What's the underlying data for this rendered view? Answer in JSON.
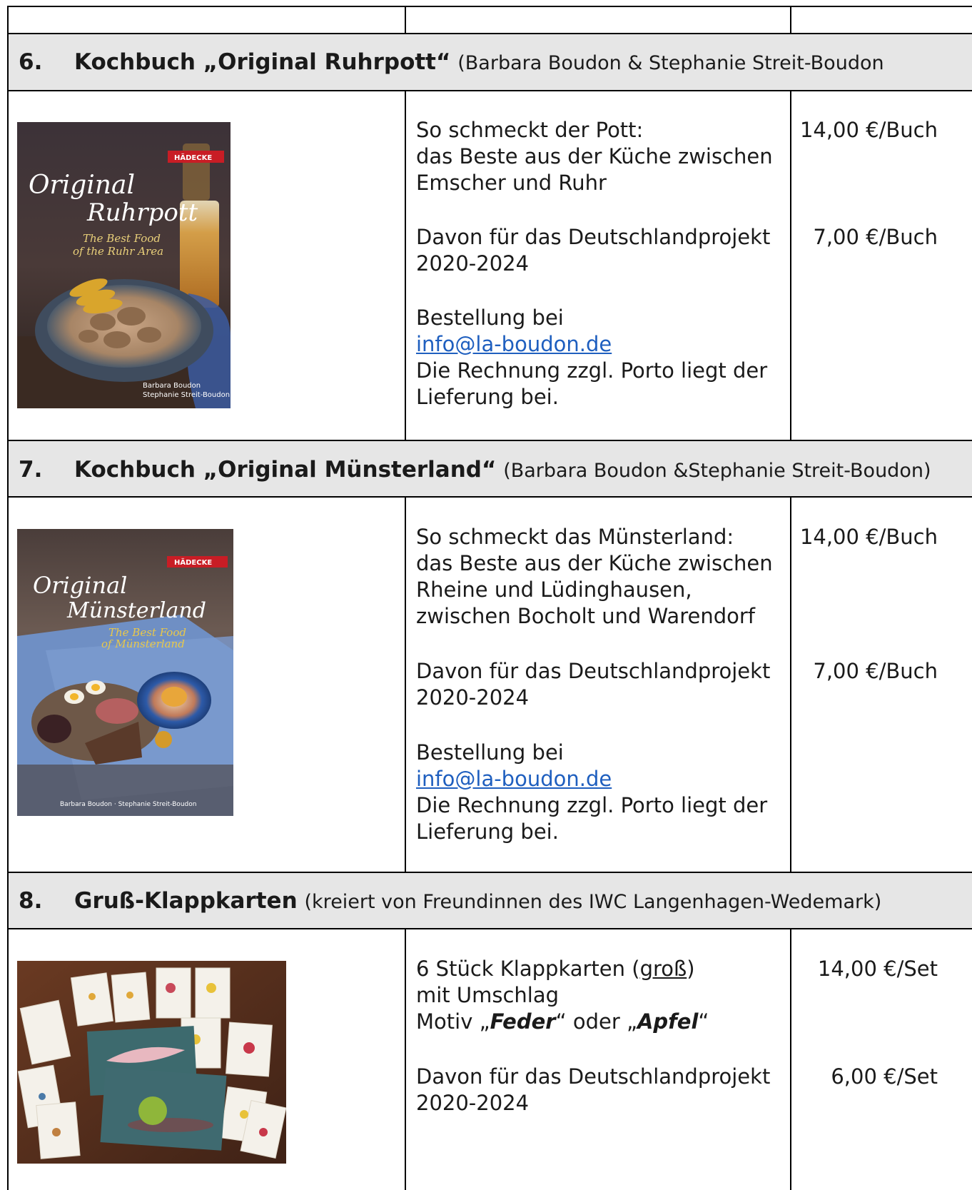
{
  "sections": [
    {
      "number": "6.",
      "title": "Kochbuch „Original Ruhrpott“",
      "subtitle": "(Barbara Boudon & Stephanie Streit-Boudon",
      "cover": {
        "publisher": "HÄDECKE",
        "title_line1": "Original",
        "title_line2": "Ruhrpott",
        "tagline1": "The Best Food",
        "tagline2": "of the Ruhr Area",
        "author1": "Barbara Boudon",
        "author2": "Stephanie Streit-Boudon"
      },
      "desc": [
        "So schmeckt der Pott:",
        "das Beste aus der Küche zwischen",
        "Emscher und Ruhr"
      ],
      "project": [
        "Davon für das Deutschlandprojekt",
        "2020-2024"
      ],
      "order_label": "Bestellung bei",
      "email": "info@la-boudon.de",
      "invoice": [
        "Die Rechnung zzgl. Porto liegt der",
        "Lieferung bei."
      ],
      "price": "14,00 €/Buch",
      "donation": "7,00 €/Buch"
    },
    {
      "number": "7.",
      "title": "Kochbuch „Original Münsterland“",
      "subtitle": "(Barbara Boudon &Stephanie Streit-Boudon)",
      "cover": {
        "publisher": "HÄDECKE",
        "title_line1": "Original",
        "title_line2": "Münsterland",
        "tagline1": "The Best Food",
        "tagline2": "of Münsterland",
        "authors": "Barbara Boudon · Stephanie Streit-Boudon"
      },
      "desc": [
        "So schmeckt das Münsterland:",
        "das Beste aus der Küche zwischen",
        "Rheine und Lüdinghausen,",
        "zwischen Bocholt und Warendorf"
      ],
      "project": [
        "Davon für das Deutschlandprojekt",
        "2020-2024"
      ],
      "order_label": "Bestellung bei",
      "email": "info@la-boudon.de",
      "invoice": [
        "Die Rechnung zzgl. Porto liegt der",
        "Lieferung bei."
      ],
      "price": "14,00 €/Buch",
      "donation": "7,00 €/Buch"
    },
    {
      "number": "8.",
      "title": "Gruß-Klappkarten",
      "subtitle": "(kreiert von Freundinnen des IWC Langenhagen-Wedemark)",
      "desc_line1_pre": "6 Stück Klappkarten (",
      "desc_line1_u": "groß",
      "desc_line1_post": ")",
      "desc_line2": "mit Umschlag",
      "motif_pre": "Motiv „",
      "motif_a": "Feder",
      "motif_mid": "“ oder „",
      "motif_b": "Apfel",
      "motif_post": "“",
      "project": [
        "Davon für das Deutschlandprojekt",
        "2020-2024"
      ],
      "price": "14,00 €/Set",
      "donation": "6,00 €/Set"
    }
  ],
  "colors": {
    "header_band": "#e6e6e6",
    "link": "#1f5fbf",
    "border": "#000000"
  }
}
